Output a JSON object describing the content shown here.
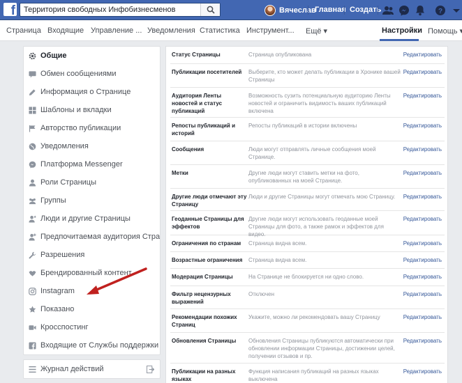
{
  "topbar": {
    "search_value": "Территория свободных Инфобизнесменов",
    "user_name": "Вячеслав",
    "home_label": "Главная",
    "create_label": "Создать",
    "icons": [
      "friends-icon",
      "messenger-icon",
      "bell-icon",
      "help-icon",
      "dropdown-icon"
    ],
    "brand_color": "#4267b2"
  },
  "nav": {
    "items": [
      "Страница",
      "Входящие",
      "Управление ...",
      "Уведомления",
      "Статистика",
      "Инструмент...",
      "Ещё ▾",
      "Настройки",
      "Помощь ▾"
    ],
    "active": "Настройки"
  },
  "sidebar": {
    "items": [
      {
        "label": "Общие",
        "icon": "gear-icon",
        "active": true
      },
      {
        "label": "Обмен сообщениями",
        "icon": "chat-bubble-icon"
      },
      {
        "label": "Информация о Странице",
        "icon": "pencil-icon"
      },
      {
        "label": "Шаблоны и вкладки",
        "icon": "grid-icon"
      },
      {
        "label": "Авторство публикации",
        "icon": "flag-icon"
      },
      {
        "label": "Уведомления",
        "icon": "globe-icon"
      },
      {
        "label": "Платформа Messenger",
        "icon": "messenger-icon"
      },
      {
        "label": "Роли Страницы",
        "icon": "person-icon"
      },
      {
        "label": "Группы",
        "icon": "group-icon"
      },
      {
        "label": "Люди и другие Страницы",
        "icon": "person-star-icon"
      },
      {
        "label": "Предпочитаемая аудитория Страницы",
        "icon": "person-add-icon"
      },
      {
        "label": "Разрешения",
        "icon": "wrench-icon"
      },
      {
        "label": "Брендированный контент",
        "icon": "handshake-icon"
      },
      {
        "label": "Instagram",
        "icon": "instagram-icon"
      },
      {
        "label": "Показано",
        "icon": "star-icon"
      },
      {
        "label": "Кросспостинг",
        "icon": "video-icon"
      },
      {
        "label": "Входящие от Службы поддержки для Стр",
        "icon": "facebook-icon"
      }
    ],
    "journal_label": "Журнал действий"
  },
  "settings": {
    "edit_label": "Редактировать",
    "rows": [
      {
        "label": "Статус Страницы",
        "value": "Страница опубликована"
      },
      {
        "label": "Публикации посетителей",
        "value": "Выберите, кто может делать публикации в Хронике вашей Страницы"
      },
      {
        "label": "Аудитория Ленты новостей и статус публикаций",
        "value": "Возможность сузить потенциальную аудиторию Ленты новостей и ограничить видимость ваших публикаций включена"
      },
      {
        "label": "Репосты публикаций и историй",
        "value": "Репосты публикаций в истории включены"
      },
      {
        "label": "Сообщения",
        "value": "Люди могут отправлять личные сообщения моей Странице."
      },
      {
        "label": "Метки",
        "value": "Другие люди могут ставить метки на фото, опубликованных на моей Странице."
      },
      {
        "label": "Другие люди отмечают эту Страницу",
        "value": "Люди и другие Страницы могут отмечать мою Страницу."
      },
      {
        "label": "Геоданные Страницы для эффектов",
        "value": "Другие люди могут использовать геоданные моей Страницы для фото, а также рамок и эффектов для видео."
      },
      {
        "label": "Ограничения по странам",
        "value": "Страница видна всем."
      },
      {
        "label": "Возрастные ограничения",
        "value": "Страница видна всем."
      },
      {
        "label": "Модерация Страницы",
        "value": "На Странице не блокируется ни одно слово."
      },
      {
        "label": "Фильтр нецензурных выражений",
        "value": "Отключен"
      },
      {
        "label": "Рекомендации похожих Страниц",
        "value": "Укажите, можно ли рекомендовать вашу Страницу"
      },
      {
        "label": "Обновления Страницы",
        "value": "Обновления Страницы публикуются автоматически при обновлении информации Страницы, достижении целей, получении отзывов и пр."
      },
      {
        "label": "Публикации на разных языках",
        "value": "Функция написания публикаций на разных языках выключена"
      }
    ]
  },
  "annotation": {
    "arrow_color": "#c0211f"
  }
}
